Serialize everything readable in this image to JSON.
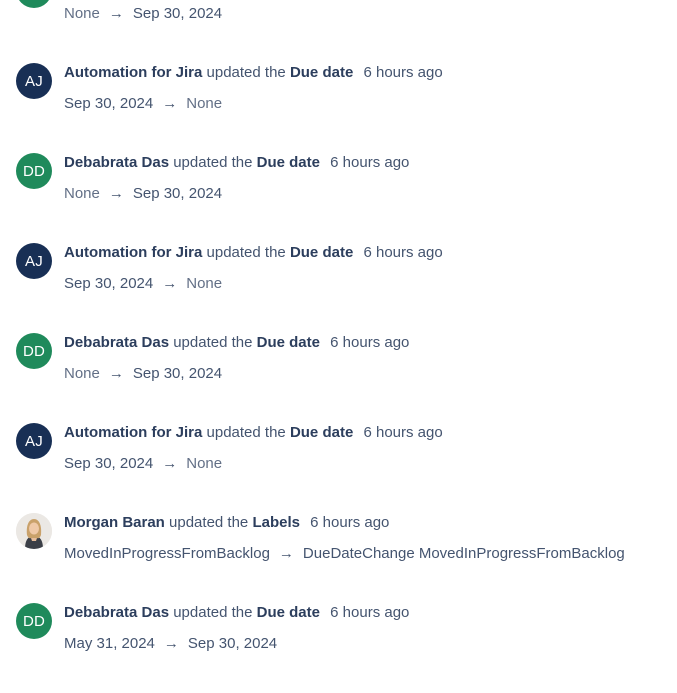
{
  "strings": {
    "updated_the": "updated the",
    "arrow": "→"
  },
  "top_partial": {
    "from": "None",
    "to": "Sep 30, 2024"
  },
  "entries": [
    {
      "initials": "AJ",
      "actor": "Automation for Jira",
      "field": "Due date",
      "time": "6 hours ago",
      "from": "Sep 30, 2024",
      "to": "None"
    },
    {
      "initials": "DD",
      "actor": "Debabrata Das",
      "field": "Due date",
      "time": "6 hours ago",
      "from": "None",
      "to": "Sep 30, 2024"
    },
    {
      "initials": "AJ",
      "actor": "Automation for Jira",
      "field": "Due date",
      "time": "6 hours ago",
      "from": "Sep 30, 2024",
      "to": "None"
    },
    {
      "initials": "DD",
      "actor": "Debabrata Das",
      "field": "Due date",
      "time": "6 hours ago",
      "from": "None",
      "to": "Sep 30, 2024"
    },
    {
      "initials": "AJ",
      "actor": "Automation for Jira",
      "field": "Due date",
      "time": "6 hours ago",
      "from": "Sep 30, 2024",
      "to": "None"
    },
    {
      "initials": "",
      "actor": "Morgan Baran",
      "field": "Labels",
      "time": "6 hours ago",
      "from": "MovedInProgressFromBacklog",
      "to": "DueDateChange MovedInProgressFromBacklog"
    },
    {
      "initials": "DD",
      "actor": "Debabrata Das",
      "field": "Due date",
      "time": "6 hours ago",
      "from": "May 31, 2024",
      "to": "Sep 30, 2024"
    }
  ],
  "colors": {
    "aj_avatar": "#182f55",
    "dd_avatar": "#1f8a5b",
    "text_bold": "#2c3e5d",
    "text_muted": "#626f86"
  }
}
